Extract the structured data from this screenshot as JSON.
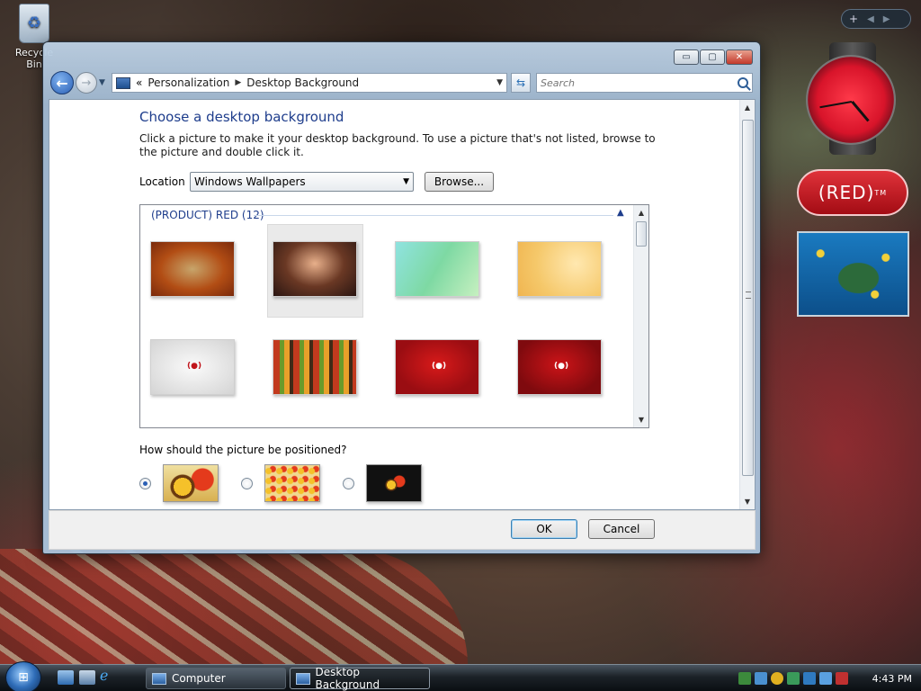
{
  "desktop": {
    "recycle_label": "Recycle Bin",
    "gadgets": {
      "red_badge": "(RED)",
      "red_badge_tm": "TM"
    }
  },
  "window": {
    "controls": {
      "minimize": "▭",
      "maximize": "▢",
      "close": "✕"
    },
    "breadcrumb": {
      "overflow": "«",
      "items": [
        "Personalization",
        "Desktop Background"
      ]
    },
    "search_placeholder": "Search",
    "heading": "Choose a desktop background",
    "description": "Click a picture to make it your desktop background. To use a picture that's not listed, browse to the picture and double click it.",
    "location_label": "Location",
    "location_value": "Windows Wallpapers",
    "browse_label": "Browse...",
    "group_header": "(PRODUCT) RED (12)",
    "selected_index": 1,
    "wallpapers": [
      {
        "name": "africa-map",
        "style": "t-africa"
      },
      {
        "name": "hands",
        "style": "t-hands"
      },
      {
        "name": "green-swirl",
        "style": "t-green"
      },
      {
        "name": "yellow-floral",
        "style": "t-yellow"
      },
      {
        "name": "white-red-logo",
        "style": "t-white"
      },
      {
        "name": "color-stripes",
        "style": "t-stripes"
      },
      {
        "name": "red-logo-1",
        "style": "t-red1"
      },
      {
        "name": "red-logo-2",
        "style": "t-red2"
      }
    ],
    "position_question": "How should the picture be positioned?",
    "position_selected": "fit",
    "ok_label": "OK",
    "cancel_label": "Cancel"
  },
  "taskbar": {
    "tasks": [
      "Computer",
      "Desktop Background"
    ],
    "active_task": "Desktop Background",
    "time": "4:43 PM"
  }
}
